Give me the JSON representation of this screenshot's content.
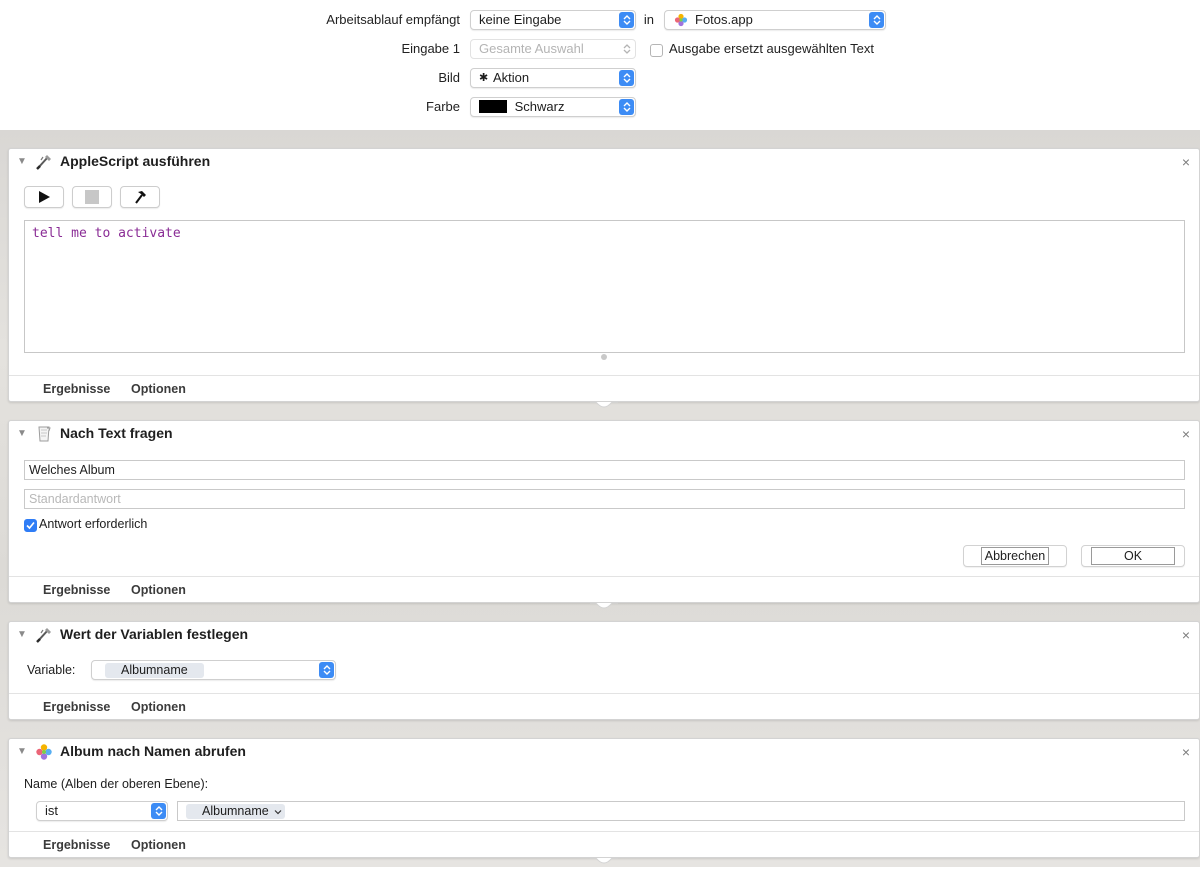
{
  "header": {
    "workflow_receives_label": "Arbeitsablauf empfängt",
    "workflow_receives_value": "keine Eingabe",
    "in_label": "in",
    "app_value": "Fotos.app",
    "input_label": "Eingabe 1",
    "input_value": "Gesamte Auswahl",
    "replace_text_label": "Ausgabe ersetzt ausgewählten Text",
    "image_label": "Bild",
    "image_value": "Aktion",
    "color_label": "Farbe",
    "color_value": "Schwarz",
    "color_hex": "#000000"
  },
  "actions": [
    {
      "title": "AppleScript ausführen",
      "script": "tell me to activate",
      "results_label": "Ergebnisse",
      "options_label": "Optionen"
    },
    {
      "title": "Nach Text fragen",
      "question_value": "Welches Album",
      "default_placeholder": "Standardantwort",
      "required_label": "Antwort erforderlich",
      "required_checked": true,
      "cancel_label": "Abbrechen",
      "ok_label": "OK",
      "results_label": "Ergebnisse",
      "options_label": "Optionen"
    },
    {
      "title": "Wert der Variablen festlegen",
      "variable_label": "Variable:",
      "variable_value": "Albumname",
      "results_label": "Ergebnisse",
      "options_label": "Optionen"
    },
    {
      "title": "Album nach Namen abrufen",
      "name_label": "Name (Alben der oberen Ebene):",
      "operator_value": "ist",
      "token_value": "Albumname",
      "results_label": "Ergebnisse",
      "options_label": "Optionen"
    }
  ],
  "close_glyph": "×",
  "colors": {
    "accent": "#3d8cf5",
    "script_text": "#8a2c95"
  }
}
